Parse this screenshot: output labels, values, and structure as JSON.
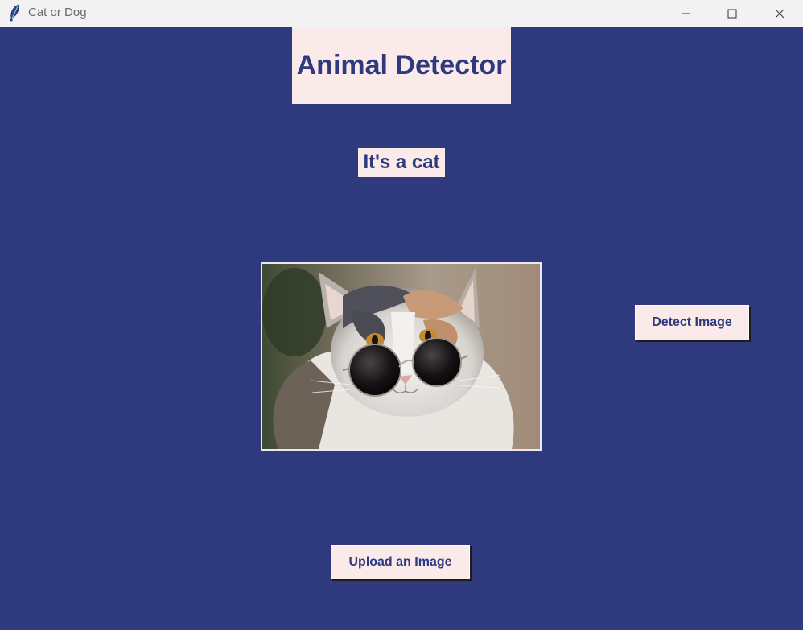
{
  "window": {
    "title": "Cat or Dog",
    "icon": "feather-icon",
    "controls": [
      "minimize-icon",
      "maximize-icon",
      "close-icon"
    ]
  },
  "main": {
    "heading": "Animal Detector",
    "result": "It's a cat",
    "image": {
      "subject": "calico cat wearing round sunglasses"
    },
    "detect_button": "Detect Image",
    "upload_button": "Upload an Image"
  },
  "colors": {
    "background": "#2f3a7e",
    "panel": "#fbeaea",
    "text": "#2f3a7e",
    "titlebar": "#f2f2f2"
  }
}
